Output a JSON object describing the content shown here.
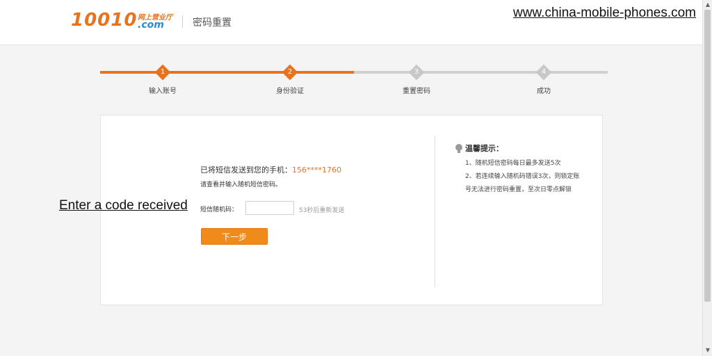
{
  "header": {
    "logo_number": "10010",
    "logo_subtitle": "网上营业厅",
    "logo_domain": ".com",
    "page_title": "密码重置"
  },
  "watermark": "www.china-mobile-phones.com",
  "annotation": "Enter a code received",
  "progress": {
    "steps": [
      {
        "num": "1",
        "label": "输入账号",
        "active": true
      },
      {
        "num": "2",
        "label": "身份验证",
        "active": true
      },
      {
        "num": "3",
        "label": "重置密码",
        "active": false
      },
      {
        "num": "4",
        "label": "成功",
        "active": false
      }
    ],
    "completed_fraction": 0.5
  },
  "form": {
    "sent_text": "已将短信发送到您的手机：",
    "phone": "156****1760",
    "instruction": "请查看并输入随机短信密码。",
    "code_label": "短信随机码：",
    "code_value": "",
    "resend_text": "53秒后重新发送",
    "next_button": "下一步"
  },
  "tips": {
    "title": "温馨提示：",
    "items": [
      "1、随机短信密码每日最多发送5次",
      "2、若连续输入随机码错误3次，则锁定账号无法进行密码重置，至次日零点解锁"
    ]
  },
  "colors": {
    "accent": "#e8731f",
    "inactive": "#c8c8c8",
    "button": "#f08a1a"
  }
}
